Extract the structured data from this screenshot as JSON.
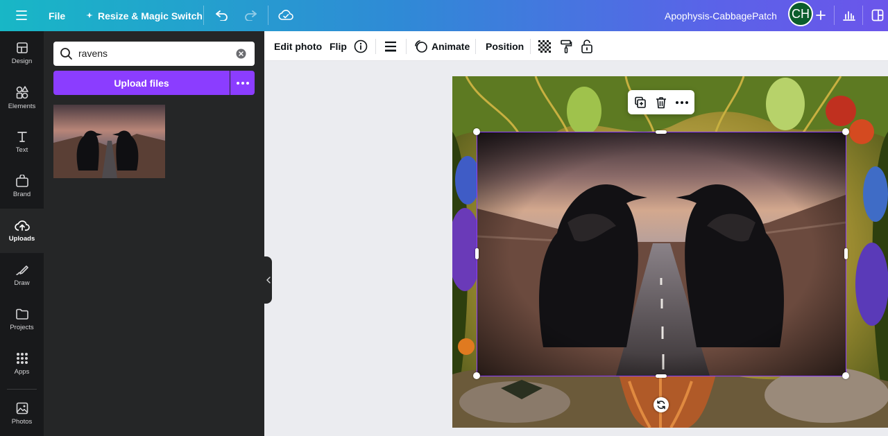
{
  "topbar": {
    "file_label": "File",
    "resize_label": "Resize & Magic Switch",
    "project_title": "Apophysis-CabbagePatch",
    "avatar_initials": "CH"
  },
  "rail": {
    "items": [
      {
        "label": "Design",
        "icon": "design-icon"
      },
      {
        "label": "Elements",
        "icon": "elements-icon"
      },
      {
        "label": "Text",
        "icon": "text-icon"
      },
      {
        "label": "Brand",
        "icon": "brand-icon"
      },
      {
        "label": "Uploads",
        "icon": "cloud-upload-icon",
        "active": true
      },
      {
        "label": "Draw",
        "icon": "draw-icon"
      },
      {
        "label": "Projects",
        "icon": "folder-icon"
      },
      {
        "label": "Apps",
        "icon": "apps-grid-icon"
      },
      {
        "label": "Photos",
        "icon": "photo-icon"
      }
    ]
  },
  "panel": {
    "search_value": "ravens",
    "upload_label": "Upload files"
  },
  "toolbar": {
    "edit_photo": "Edit photo",
    "flip": "Flip",
    "animate": "Animate",
    "position": "Position"
  },
  "colors": {
    "accent": "#8b3dff",
    "topbar_start": "#18b7c6",
    "topbar_end": "#6b55ea",
    "rail_bg": "#18191b",
    "panel_bg": "#252627"
  }
}
